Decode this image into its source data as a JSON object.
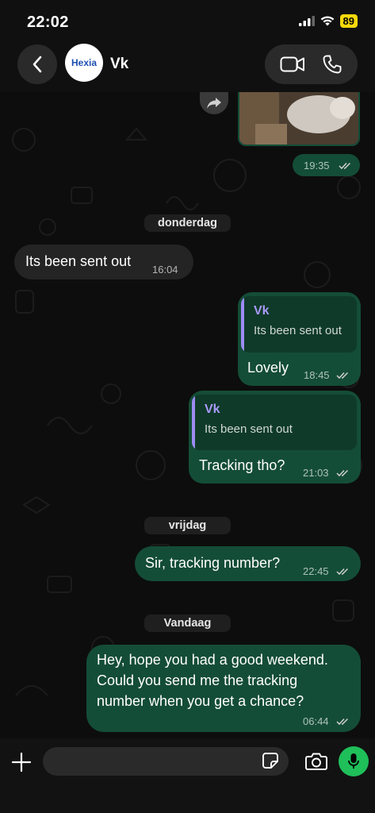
{
  "status_bar": {
    "time": "22:02",
    "battery": "89"
  },
  "header": {
    "contact_name": "Vk",
    "avatar_logo": "Hexia"
  },
  "colors": {
    "outgoing_bubble": "#144d37",
    "incoming_bubble": "#242424",
    "quote_name": "#a99af8",
    "mic_button": "#1fbf5a",
    "battery": "#f5d90a"
  },
  "messages": [
    {
      "id": "media",
      "direction": "outgoing",
      "time": "19:35",
      "status": "read"
    },
    {
      "id": "date-1",
      "type": "date",
      "label": "donderdag"
    },
    {
      "id": "m1",
      "direction": "incoming",
      "text": "Its been sent out",
      "time": "16:04"
    },
    {
      "id": "m2",
      "direction": "outgoing",
      "quote_name": "Vk",
      "quote_text": "Its been sent out",
      "text": "Lovely",
      "time": "18:45",
      "status": "read"
    },
    {
      "id": "m3",
      "direction": "outgoing",
      "quote_name": "Vk",
      "quote_text": "Its been sent out",
      "text": "Tracking tho?",
      "time": "21:03",
      "status": "read"
    },
    {
      "id": "date-2",
      "type": "date",
      "label": "vrijdag"
    },
    {
      "id": "m4",
      "direction": "outgoing",
      "text": "Sir, tracking number?",
      "time": "22:45",
      "status": "read"
    },
    {
      "id": "date-3",
      "type": "date",
      "label": "Vandaag"
    },
    {
      "id": "m5",
      "direction": "outgoing",
      "lines": [
        "Hey, hope you had a good weekend.",
        "Could you send me the tracking",
        "number when you get a chance?"
      ],
      "time": "06:44",
      "status": "read"
    }
  ],
  "icons": [
    "chevron-left-icon",
    "video-camera-icon",
    "phone-icon",
    "forward-icon",
    "read-ticks-icon",
    "plus-icon",
    "sticker-icon",
    "camera-icon",
    "microphone-icon"
  ],
  "composer": {
    "placeholder": ""
  }
}
